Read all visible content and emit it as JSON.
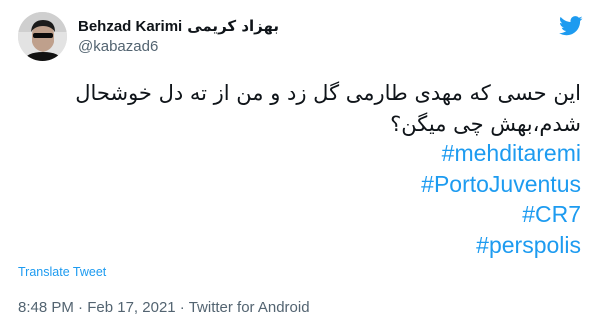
{
  "author": {
    "name_en": "Behzad Karimi",
    "name_fa": "بهزاد کریمی",
    "handle": "@kabazad6",
    "avatar_icon": "avatar-photo"
  },
  "tweet": {
    "text_line_1": "این حسی که مهدی طارمی گل زد و من از ته دل خوشحال",
    "text_line_2": "شدم،بهش چی میگن؟",
    "hashtags": [
      "#mehditaremi",
      "#PortoJuventus",
      "#CR7",
      "#perspolis"
    ],
    "translate_label": "Translate Tweet"
  },
  "meta": {
    "time": "8:48 PM",
    "separator_1": " · ",
    "date": "Feb 17, 2021",
    "separator_2": " · ",
    "source": "Twitter for Android"
  },
  "colors": {
    "accent": "#1d9bf0",
    "text": "#0f1419",
    "secondary": "#536471"
  },
  "icons": {
    "brand": "twitter-bird-icon"
  }
}
